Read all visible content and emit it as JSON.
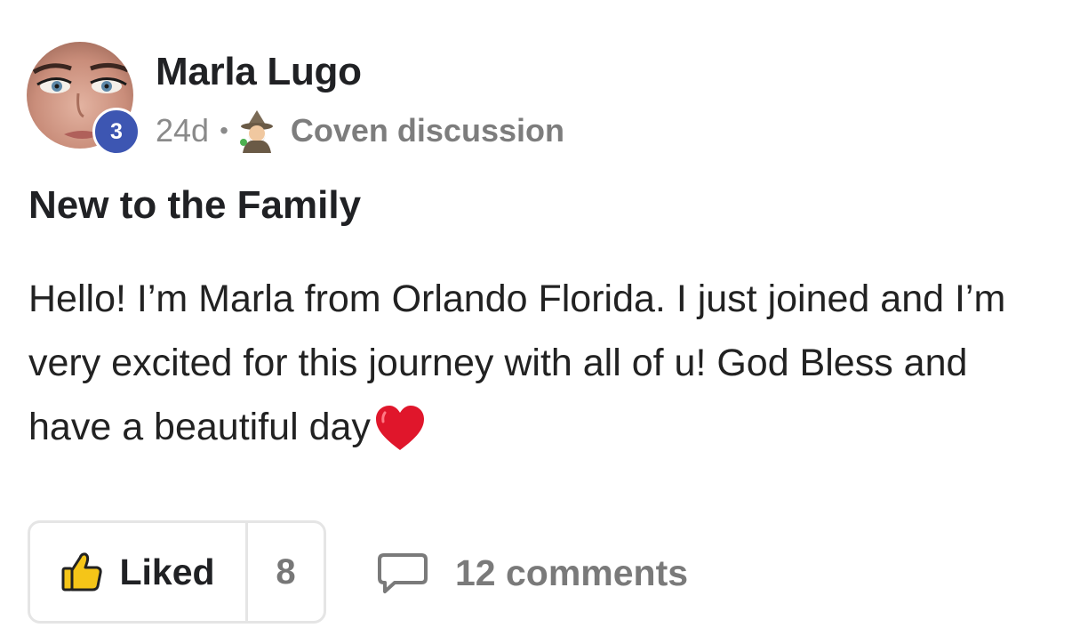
{
  "post": {
    "author": "Marla Lugo",
    "level": "3",
    "age": "24d",
    "separator": "•",
    "category": "Coven discussion",
    "category_icon": "wizard-emoji-icon",
    "title": "New to the Family",
    "body": "Hello! I’m Marla from Orlando Florida. I just joined and I’m very excited for this journey with all of u! God Bless and have a beautiful day"
  },
  "actions": {
    "like_label": "Liked",
    "like_count": "8",
    "comments_label": "12 comments",
    "like_icon": "thumbs-up-icon",
    "comment_icon": "comment-bubble-icon"
  },
  "colors": {
    "level_badge": "#3d56b2",
    "like_icon_fill": "#f5c518",
    "heart": "#e0162b",
    "muted_text": "#8a8a8a"
  }
}
